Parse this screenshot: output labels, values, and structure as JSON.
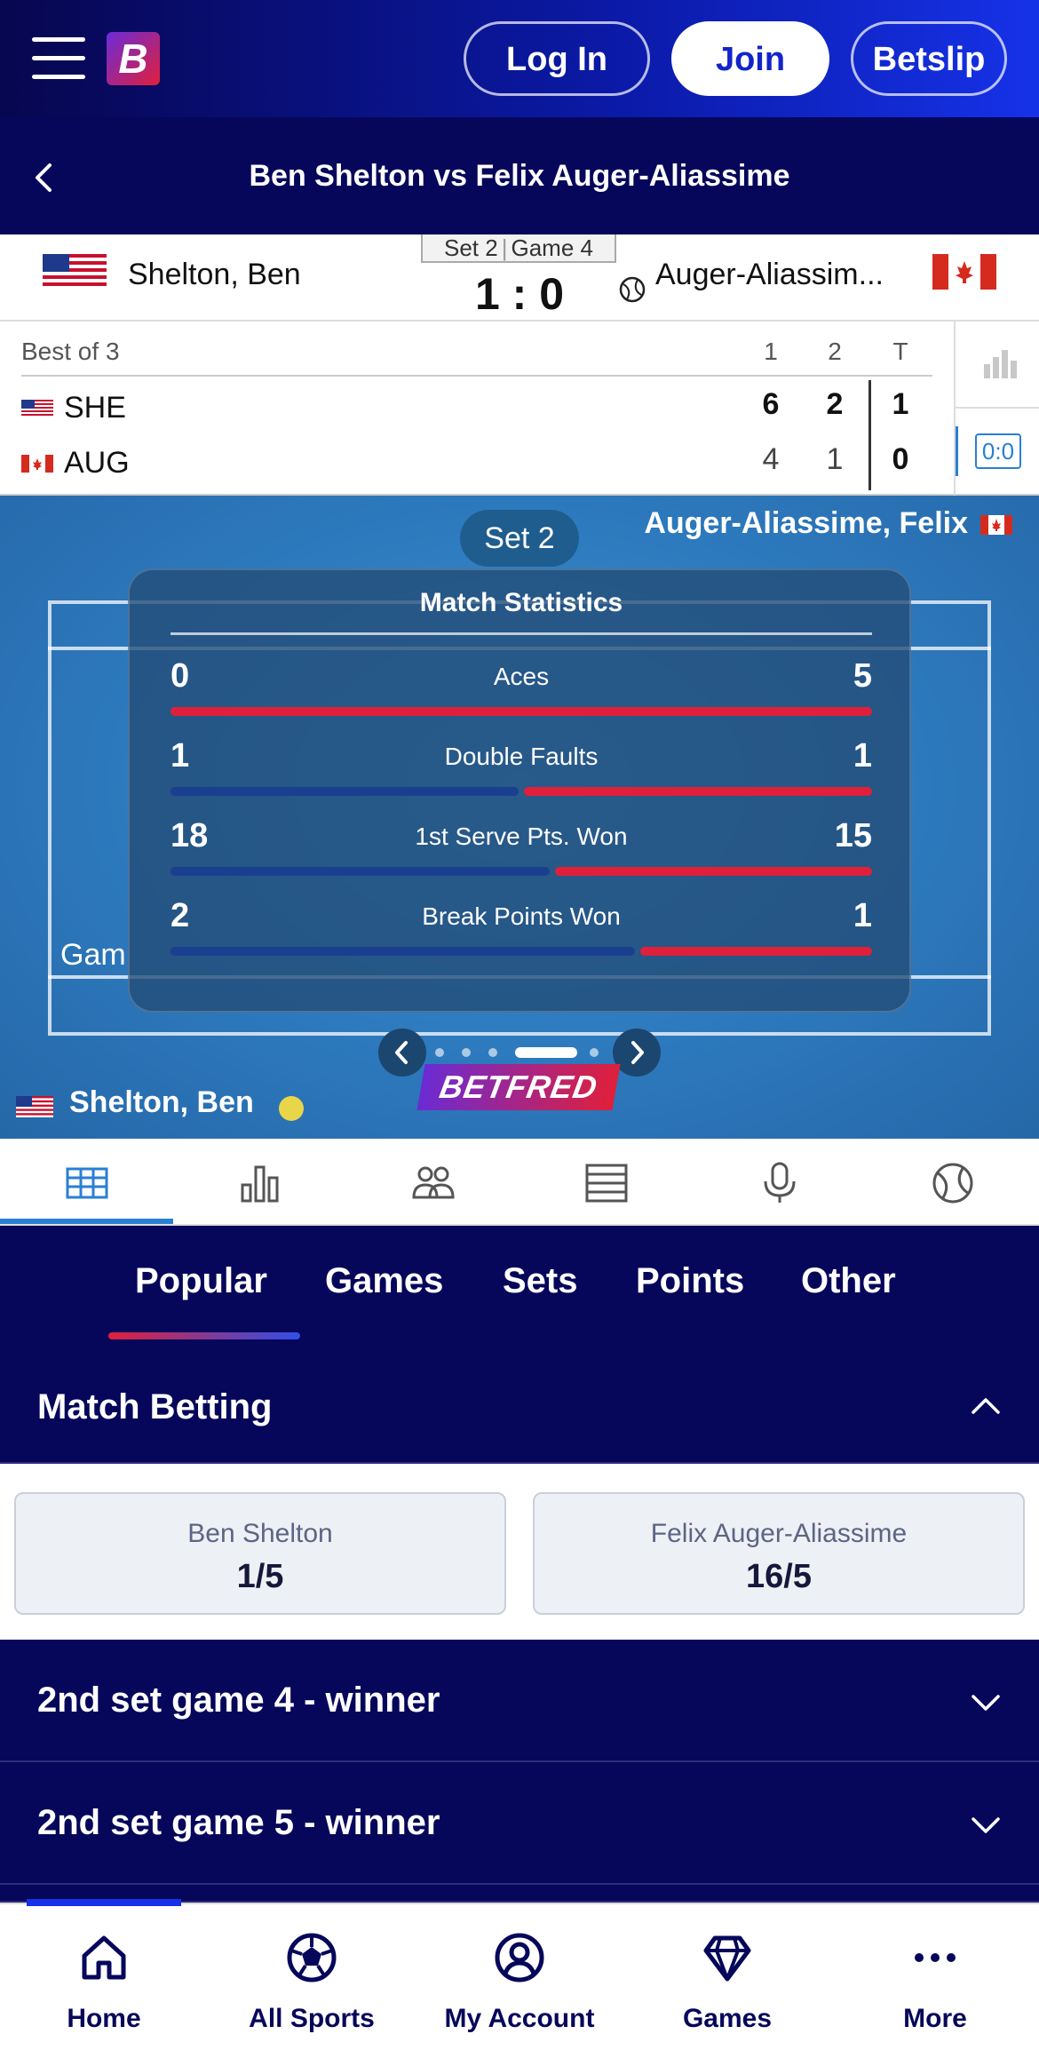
{
  "header": {
    "login_label": "Log In",
    "join_label": "Join",
    "betslip_label": "Betslip",
    "logo_letter": "B",
    "brand_colors": {
      "primary": "#06075a",
      "accent": "#1632e8",
      "red": "#e0203a"
    }
  },
  "titlebar": {
    "title": "Ben Shelton vs Felix Auger-Aliassime",
    "back_icon": "chevron-left-icon"
  },
  "score_header": {
    "player1": "Shelton, Ben",
    "player2": "Auger-Aliassim...",
    "set_label": "Set 2",
    "game_label": "Game 4",
    "score": "1 : 0"
  },
  "score_table": {
    "format": "Best of 3",
    "columns": [
      "1",
      "2",
      "T"
    ],
    "rows": [
      {
        "code": "SHE",
        "values": [
          "6",
          "2",
          "1"
        ]
      },
      {
        "code": "AUG",
        "values": [
          "4",
          "1",
          "0"
        ]
      }
    ],
    "live_badge": "0:0"
  },
  "court": {
    "set_pill": "Set 2",
    "top_player": "Auger-Aliassime, Felix",
    "bottom_player": "Shelton, Ben",
    "partial_label": "Gam",
    "sponsor": "BETFRED",
    "carousel_pages": 6,
    "carousel_active": 4,
    "stats": {
      "title": "Match Statistics",
      "rows": [
        {
          "label": "Aces",
          "left": "0",
          "right": "5",
          "left_share": 0.0
        },
        {
          "label": "Double Faults",
          "left": "1",
          "right": "1",
          "left_share": 0.5
        },
        {
          "label": "1st Serve Pts. Won",
          "left": "18",
          "right": "15",
          "left_share": 0.545
        },
        {
          "label": "Break Points Won",
          "left": "2",
          "right": "1",
          "left_share": 0.667
        }
      ]
    }
  },
  "tabs": [
    "scoreboard-icon",
    "stats-icon",
    "lineups-icon",
    "list-icon",
    "commentary-mic-icon",
    "tennis-ball-icon"
  ],
  "market_nav": {
    "items": [
      "Popular",
      "Games",
      "Sets",
      "Points",
      "Other"
    ],
    "active": "Popular"
  },
  "match_betting": {
    "title": "Match Betting",
    "selections": [
      {
        "name": "Ben Shelton",
        "price": "1/5"
      },
      {
        "name": "Felix Auger-Aliassime",
        "price": "16/5"
      }
    ]
  },
  "sections": [
    {
      "title": "2nd set game 4 - winner"
    },
    {
      "title": "2nd set game 5 - winner"
    }
  ],
  "bottom_nav": {
    "items": [
      {
        "label": "Home",
        "icon": "home-icon"
      },
      {
        "label": "All Sports",
        "icon": "football-icon"
      },
      {
        "label": "My Account",
        "icon": "account-icon"
      },
      {
        "label": "Games",
        "icon": "diamond-icon"
      },
      {
        "label": "More",
        "icon": "more-dots-icon"
      }
    ],
    "active": "Home"
  }
}
